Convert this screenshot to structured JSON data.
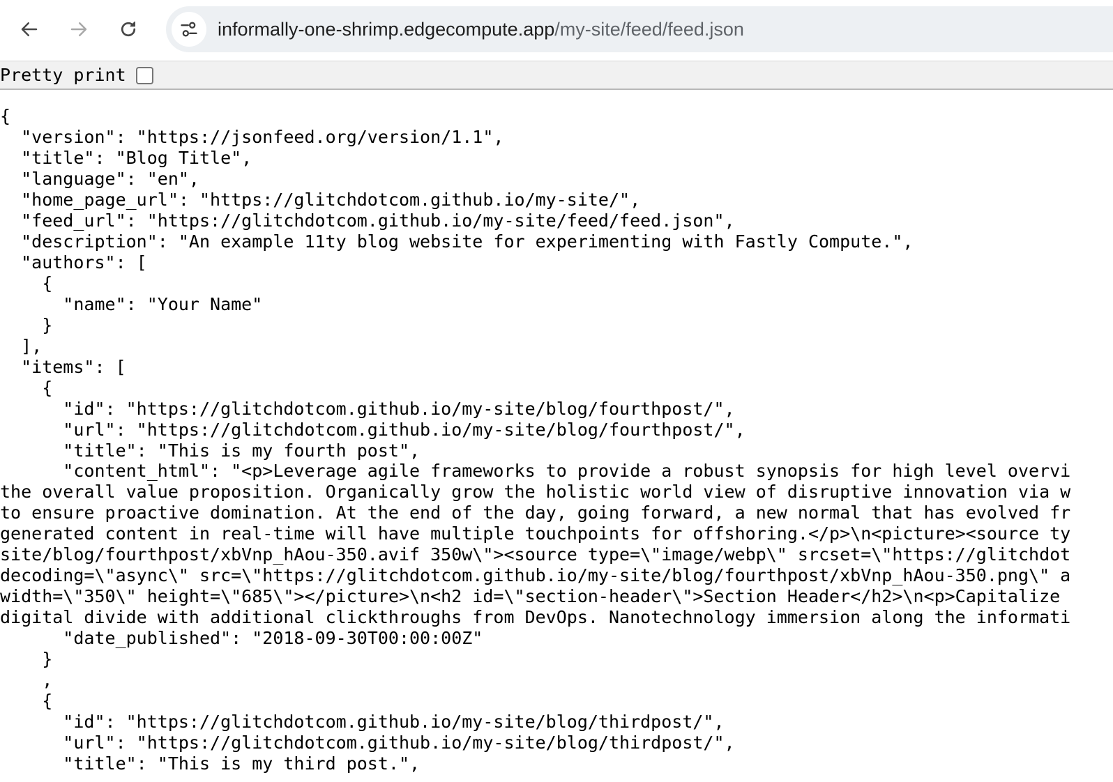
{
  "browser": {
    "url_host": "informally-one-shrimp.edgecompute.app",
    "url_path": "/my-site/feed/feed.json"
  },
  "viewer": {
    "pretty_print_label": "Pretty print",
    "pretty_print_checked": false
  },
  "json_lines": [
    "{",
    "  \"version\": \"https://jsonfeed.org/version/1.1\",",
    "  \"title\": \"Blog Title\",",
    "  \"language\": \"en\",",
    "  \"home_page_url\": \"https://glitchdotcom.github.io/my-site/\",",
    "  \"feed_url\": \"https://glitchdotcom.github.io/my-site/feed/feed.json\",",
    "  \"description\": \"An example 11ty blog website for experimenting with Fastly Compute.\",",
    "  \"authors\": [",
    "    {",
    "      \"name\": \"Your Name\"",
    "    }",
    "  ],",
    "  \"items\": [",
    "    {",
    "      \"id\": \"https://glitchdotcom.github.io/my-site/blog/fourthpost/\",",
    "      \"url\": \"https://glitchdotcom.github.io/my-site/blog/fourthpost/\",",
    "      \"title\": \"This is my fourth post\",",
    "      \"content_html\": \"<p>Leverage agile frameworks to provide a robust synopsis for high level overvi",
    "the overall value proposition. Organically grow the holistic world view of disruptive innovation via w",
    "to ensure proactive domination. At the end of the day, going forward, a new normal that has evolved fr",
    "generated content in real-time will have multiple touchpoints for offshoring.</p>\\n<picture><source ty",
    "site/blog/fourthpost/xbVnp_hAou-350.avif 350w\\\"><source type=\\\"image/webp\\\" srcset=\\\"https://glitchdot",
    "decoding=\\\"async\\\" src=\\\"https://glitchdotcom.github.io/my-site/blog/fourthpost/xbVnp_hAou-350.png\\\" a",
    "width=\\\"350\\\" height=\\\"685\\\"></picture>\\n<h2 id=\\\"section-header\\\">Section Header</h2>\\n<p>Capitalize ",
    "digital divide with additional clickthroughs from DevOps. Nanotechnology immersion along the informati",
    "      \"date_published\": \"2018-09-30T00:00:00Z\"",
    "    }",
    "    ,",
    "    {",
    "      \"id\": \"https://glitchdotcom.github.io/my-site/blog/thirdpost/\",",
    "      \"url\": \"https://glitchdotcom.github.io/my-site/blog/thirdpost/\",",
    "      \"title\": \"This is my third post.\","
  ]
}
